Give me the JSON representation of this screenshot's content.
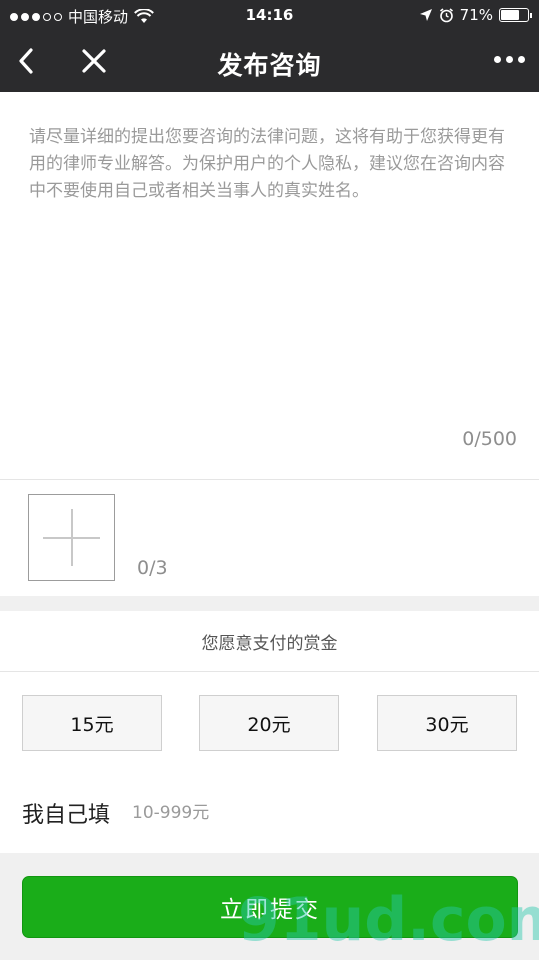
{
  "status_bar": {
    "carrier": "中国移动",
    "time": "14:16",
    "battery": "71%",
    "battery_level": 0.71,
    "icons": [
      "wifi-icon",
      "location-icon",
      "alarm-icon",
      "battery-icon"
    ]
  },
  "nav": {
    "title": "发布咨询",
    "icons": [
      "back-arrow-icon",
      "close-icon",
      "more-icon"
    ]
  },
  "question": {
    "placeholder": "请尽量详细的提出您要咨询的法律问题，这将有助于您获得更有用的律师专业解答。为保护用户的个人隐私，建议您在咨询内容中不要使用自己或者相关当事人的真实姓名。",
    "value": "",
    "count": "0/500"
  },
  "images": {
    "count": "0/3",
    "icon": "plus-icon"
  },
  "reward": {
    "label": "您愿意支付的赏金",
    "options": [
      "15元",
      "20元",
      "30元"
    ],
    "custom_label": "我自己填",
    "custom_placeholder": "10-999元"
  },
  "submit": {
    "label": "立即提交"
  },
  "watermark": {
    "text": "91ud.com"
  },
  "colors": {
    "bar_bg": "#2b2b2d",
    "submit_green": "#1aad19",
    "gray_band": "#f0f0f0"
  }
}
